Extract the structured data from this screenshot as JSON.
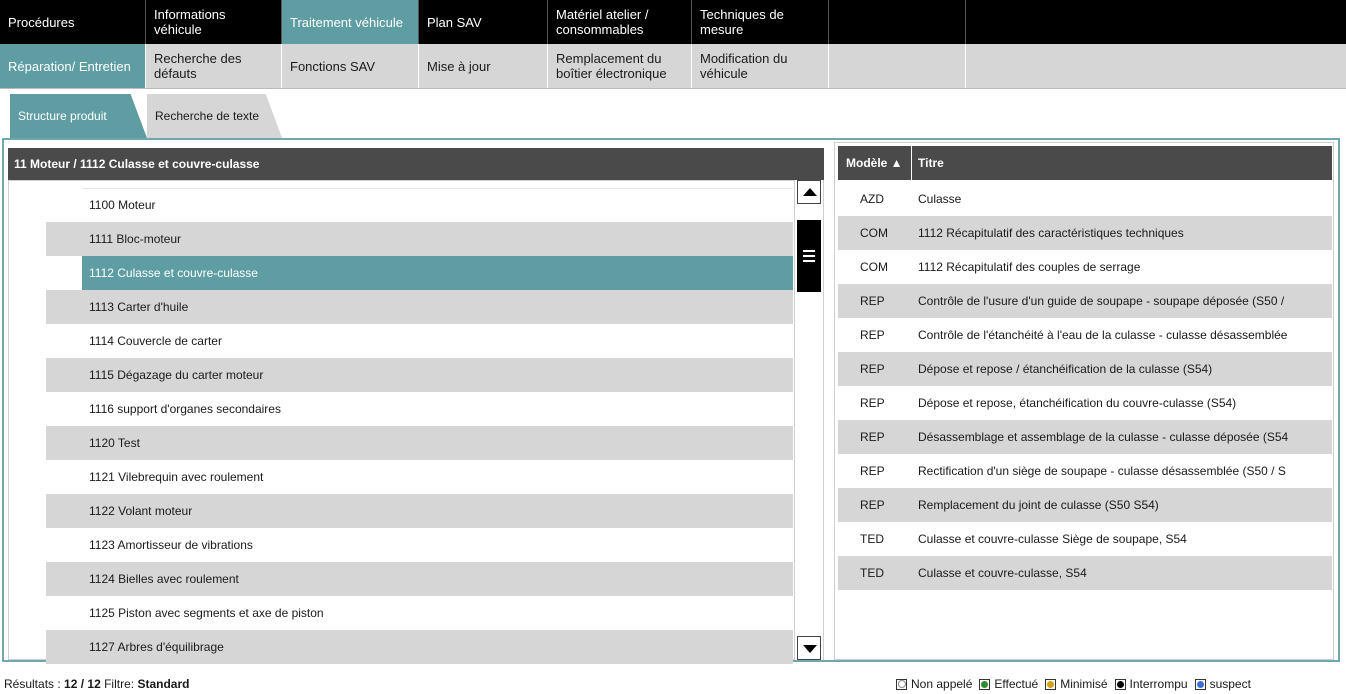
{
  "nav_main": [
    {
      "label": "Procédures"
    },
    {
      "label": "Informations véhicule"
    },
    {
      "label": "Traitement véhicule"
    },
    {
      "label": "Plan SAV"
    },
    {
      "label": "Matériel atelier / consommables"
    },
    {
      "label": "Techniques de mesure"
    },
    {
      "label": ""
    },
    {
      "label": ""
    }
  ],
  "nav_sub": [
    {
      "label": "Réparation/ Entretien"
    },
    {
      "label": "Recherche des défauts"
    },
    {
      "label": "Fonctions SAV"
    },
    {
      "label": "Mise à jour"
    },
    {
      "label": "Remplacement du boîtier électronique"
    },
    {
      "label": "Modification du véhicule"
    },
    {
      "label": ""
    },
    {
      "label": ""
    }
  ],
  "tabs": [
    {
      "label": "Structure produit"
    },
    {
      "label": "Recherche de texte"
    }
  ],
  "left_panel": {
    "title": "11 Moteur / 1112 Culasse et couvre-culasse",
    "items": [
      {
        "label": "1100 Moteur"
      },
      {
        "label": "1111 Bloc-moteur"
      },
      {
        "label": "1112 Culasse et couvre-culasse"
      },
      {
        "label": "1113 Carter d'huile"
      },
      {
        "label": "1114 Couvercle de carter"
      },
      {
        "label": "1115 Dégazage du carter moteur"
      },
      {
        "label": "1116 support d'organes secondaires"
      },
      {
        "label": "1120 Test"
      },
      {
        "label": "1121 Vilebrequin avec roulement"
      },
      {
        "label": "1122 Volant moteur"
      },
      {
        "label": "1123 Amortisseur de vibrations"
      },
      {
        "label": "1124 Bielles avec roulement"
      },
      {
        "label": "1125 Piston avec segments et axe de piston"
      },
      {
        "label": "1127 Arbres d'équilibrage"
      }
    ],
    "selected_index": 2
  },
  "right_panel": {
    "col_model": "Modèle ▲",
    "col_title": "Titre",
    "rows": [
      {
        "model": "AZD",
        "title": "Culasse"
      },
      {
        "model": "COM",
        "title": "1112 Récapitulatif des caractéristiques techniques"
      },
      {
        "model": "COM",
        "title": "1112 Récapitulatif des couples de serrage"
      },
      {
        "model": "REP",
        "title": "Contrôle de l'usure d'un guide de soupape - soupape déposée (S50 /"
      },
      {
        "model": "REP",
        "title": "Contrôle de l'étanchéité à l'eau de la culasse - culasse désassemblée"
      },
      {
        "model": "REP",
        "title": "Dépose et repose / étanchéification de la culasse (S54)"
      },
      {
        "model": "REP",
        "title": "Dépose et repose, étanchéification du couvre-culasse (S54)"
      },
      {
        "model": "REP",
        "title": "Désassemblage et assemblage de la culasse - culasse déposée (S54"
      },
      {
        "model": "REP",
        "title": "Rectification d'un siège de soupape - culasse désassemblée (S50 / S"
      },
      {
        "model": "REP",
        "title": "Remplacement du joint de culasse (S50 S54)"
      },
      {
        "model": "TED",
        "title": "Culasse et couvre-culasse Siège de soupape, S54"
      },
      {
        "model": "TED",
        "title": "Culasse et couvre-culasse, S54"
      }
    ]
  },
  "footer": {
    "results_label": "Résultats :",
    "results_value": "12 / 12",
    "filter_label": "Filtre:",
    "filter_value": "Standard"
  },
  "legend": [
    {
      "label": "Non appelé",
      "color": "#ffffff"
    },
    {
      "label": "Effectué",
      "color": "#2e8b2e"
    },
    {
      "label": "Minimisé",
      "color": "#d4a017"
    },
    {
      "label": "Interrompu",
      "color": "#000000"
    },
    {
      "label": "suspect",
      "color": "#3a6fd8"
    }
  ]
}
